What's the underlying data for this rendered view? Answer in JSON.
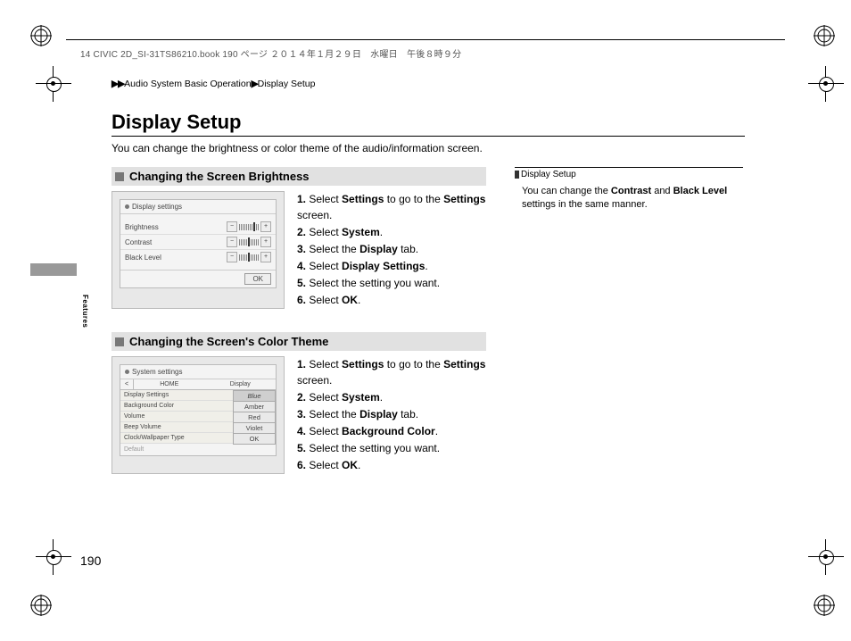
{
  "header_line": "14 CIVIC 2D_SI-31TS86210.book  190 ページ  ２０１４年１月２９日　水曜日　午後８時９分",
  "breadcrumb": {
    "arrows": "▶▶",
    "path1": "Audio System Basic Operation",
    "sep": "▶",
    "path2": "Display Setup"
  },
  "title": "Display Setup",
  "intro": "You can change the brightness or color theme of the audio/information screen.",
  "section1": {
    "heading": "Changing the Screen Brightness",
    "shot": {
      "panel_title": "Display settings",
      "rows": [
        "Brightness",
        "Contrast",
        "Black Level"
      ],
      "minus": "−",
      "plus": "+",
      "ok": "OK"
    },
    "steps": [
      {
        "n": "1.",
        "pre": "Select ",
        "b1": "Settings",
        "mid": " to go to the ",
        "b2": "Settings",
        "post": " screen."
      },
      {
        "n": "2.",
        "pre": "Select ",
        "b1": "System",
        "mid": "",
        "b2": "",
        "post": "."
      },
      {
        "n": "3.",
        "pre": "Select the ",
        "b1": "Display",
        "mid": "",
        "b2": "",
        "post": " tab."
      },
      {
        "n": "4.",
        "pre": "Select ",
        "b1": "Display Settings",
        "mid": "",
        "b2": "",
        "post": "."
      },
      {
        "n": "5.",
        "pre": "Select the setting you want.",
        "b1": "",
        "mid": "",
        "b2": "",
        "post": ""
      },
      {
        "n": "6.",
        "pre": "Select ",
        "b1": "OK",
        "mid": "",
        "b2": "",
        "post": "."
      }
    ]
  },
  "section2": {
    "heading": "Changing the Screen's Color Theme",
    "shot": {
      "panel_title": "System settings",
      "back": "<",
      "tab1": "HOME",
      "tab2": "Display",
      "list": [
        "Display Settings",
        "Background Color",
        "Volume",
        "Beep Volume",
        "Clock/Wallpaper Type"
      ],
      "options": [
        "Blue",
        "Amber",
        "Red",
        "Violet",
        "OK"
      ],
      "footer": "Default"
    },
    "steps": [
      {
        "n": "1.",
        "pre": "Select ",
        "b1": "Settings",
        "mid": " to go to the ",
        "b2": "Settings",
        "post": " screen."
      },
      {
        "n": "2.",
        "pre": "Select ",
        "b1": "System",
        "mid": "",
        "b2": "",
        "post": "."
      },
      {
        "n": "3.",
        "pre": "Select the ",
        "b1": "Display",
        "mid": "",
        "b2": "",
        "post": " tab."
      },
      {
        "n": "4.",
        "pre": "Select ",
        "b1": "Background Color",
        "mid": "",
        "b2": "",
        "post": "."
      },
      {
        "n": "5.",
        "pre": "Select the setting you want.",
        "b1": "",
        "mid": "",
        "b2": "",
        "post": ""
      },
      {
        "n": "6.",
        "pre": "Select ",
        "b1": "OK",
        "mid": "",
        "b2": "",
        "post": "."
      }
    ]
  },
  "sidebar": {
    "title": "Display Setup",
    "line1_pre": "You can change the ",
    "line1_b1": "Contrast",
    "line1_mid": " and ",
    "line1_b2": "Black Level",
    "line2": "settings in the same manner."
  },
  "side_label": "Features",
  "page_number": "190"
}
